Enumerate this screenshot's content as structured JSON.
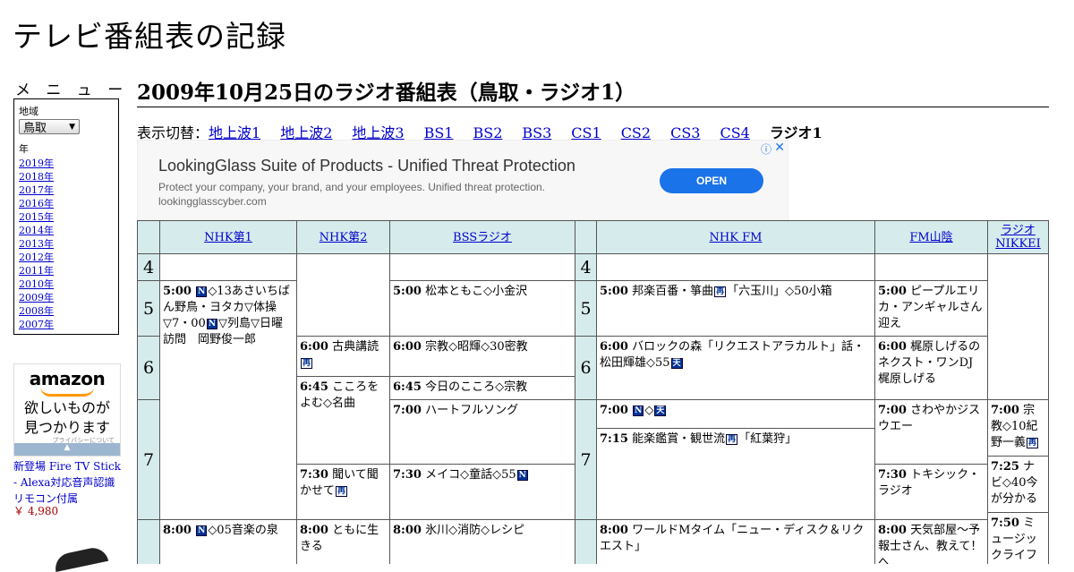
{
  "site_title": "テレビ番組表の記録",
  "sidebar": {
    "menu_label": "メ ニ ュ ー",
    "region_label": "地域",
    "region_value": "鳥取",
    "year_label": "年",
    "years": [
      "2019年",
      "2018年",
      "2017年",
      "2016年",
      "2015年",
      "2014年",
      "2013年",
      "2012年",
      "2011年",
      "2010年",
      "2009年",
      "2008年",
      "2007年"
    ]
  },
  "amazon_ad": {
    "logo": "amazon",
    "copy_line1": "欲しいものが",
    "copy_line2": "見つかります",
    "privacy": "プライバシーについて",
    "product_name": "新登場 Fire TV Stick - Alexa対応音声認識リモコン付属",
    "product_price": "￥ 4,980"
  },
  "heading": "2009年10月25日のラジオ番組表（鳥取・ラジオ1）",
  "switcher": {
    "label": "表示切替：",
    "links": [
      "地上波1",
      "地上波2",
      "地上波3",
      "BS1",
      "BS2",
      "BS3",
      "CS1",
      "CS2",
      "CS3",
      "CS4"
    ],
    "current": "ラジオ1"
  },
  "ad": {
    "title": "LookingGlass Suite of Products - Unified Threat Protection",
    "description": "Protect your company, your brand, and your employees. Unified threat protection.",
    "url": "lookingglasscyber.com",
    "button": "OPEN",
    "info_icon": "ⓘ",
    "close_icon": "✕"
  },
  "channels": [
    "NHK第1",
    "NHK第2",
    "BSSラジオ",
    "NHK FM",
    "FM山陰",
    "ラジオ NIKKEI"
  ],
  "hours": [
    "4",
    "5",
    "6",
    "7",
    "8"
  ],
  "programs": {
    "nhk1_500": {
      "time": "5:00",
      "a": "◇13あさいちばん野鳥・ヨタカ▽体操▽7・00",
      "b": "▽列島▽日曜訪問　岡野俊一郎"
    },
    "nhk1_800": {
      "time": "8:00",
      "text": "◇05音楽の泉"
    },
    "nhk2_600": {
      "time": "6:00",
      "text": "古典講読"
    },
    "nhk2_645": {
      "time": "6:45",
      "text": "こころをよむ◇名曲"
    },
    "nhk2_730": {
      "time": "7:30",
      "text": "聞いて聞かせて"
    },
    "nhk2_800": {
      "time": "8:00",
      "text": "ともに生きる"
    },
    "bss_500": {
      "time": "5:00",
      "text": "松本ともこ◇小金沢"
    },
    "bss_600": {
      "time": "6:00",
      "text": "宗教◇昭輝◇30密教"
    },
    "bss_645": {
      "time": "6:45",
      "text": "今日のこころ◇宗教"
    },
    "bss_700": {
      "time": "7:00",
      "text": "ハートフルソング"
    },
    "bss_730": {
      "time": "7:30",
      "text": "メイコ◇童話◇55"
    },
    "bss_800": {
      "time": "8:00",
      "text": "氷川◇消防◇レシピ"
    },
    "fm_500": {
      "time": "5:00",
      "a": "邦楽百番・箏曲",
      "b": "「六玉川」◇50小箱"
    },
    "fm_600": {
      "time": "6:00",
      "text": "バロックの森「リクエストアラカルト」話・松田輝雄◇55"
    },
    "fm_700": {
      "time": "7:00",
      "text": "◇"
    },
    "fm_715": {
      "time": "7:15",
      "a": "能楽鑑賞・観世流",
      "b": "「紅葉狩」"
    },
    "fm_800": {
      "time": "8:00",
      "text": "ワールドMタイム「ニュー・ディスク＆リクエスト」"
    },
    "sanin_500": {
      "time": "5:00",
      "text": "ピープルエリカ・アンギャルさん迎え"
    },
    "sanin_600": {
      "time": "6:00",
      "text": "梶原しげるのネクスト・ワンDJ 梶原しげる"
    },
    "sanin_700": {
      "time": "7:00",
      "text": "さわやかジスウエー"
    },
    "sanin_730": {
      "time": "7:30",
      "text": "トキシック・ラジオ"
    },
    "sanin_800": {
      "time": "8:00",
      "text": "天気部屋～予報士さん、教えて！へ"
    },
    "nikkei_700": {
      "time": "7:00",
      "text": "宗教◇10紀野一義"
    },
    "nikkei_725": {
      "time": "7:25",
      "text": "ナビ◇40今が分かる"
    },
    "nikkei_750": {
      "time": "7:50",
      "text": "ミュージックライフ"
    }
  },
  "icons": {
    "news": "N",
    "rebroadcast": "再",
    "stereo": "天"
  }
}
